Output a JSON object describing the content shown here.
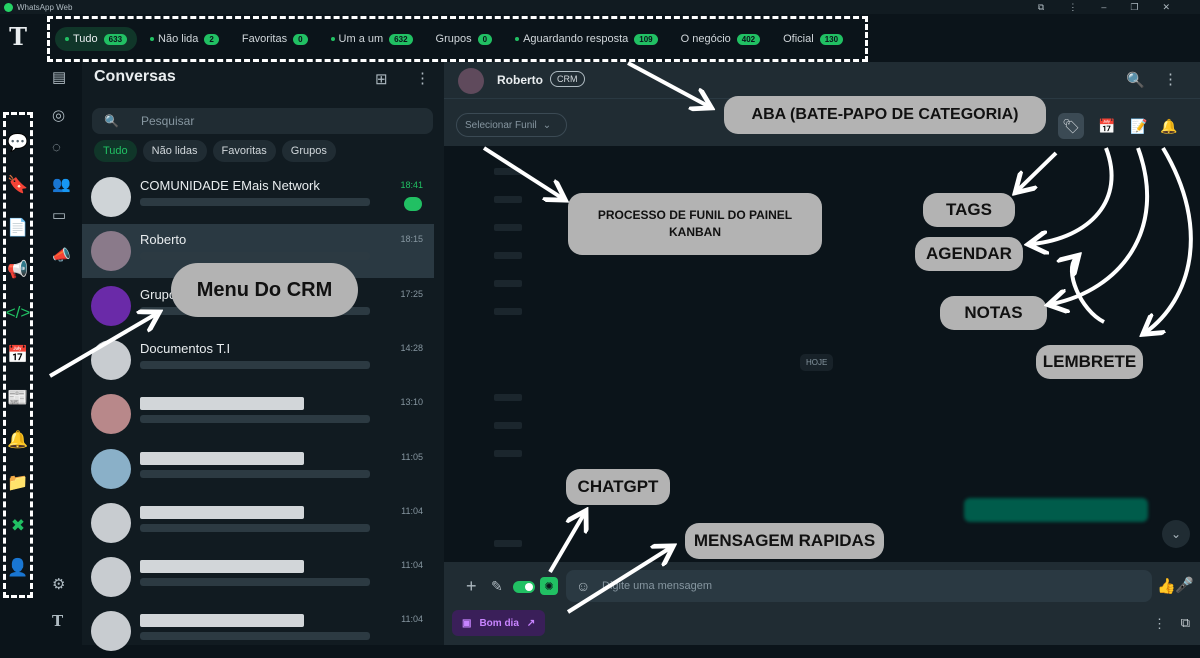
{
  "window": {
    "title": "WhatsApp Web",
    "minimize": "–",
    "restore": "❐",
    "close": "✕",
    "menu": "⋮",
    "ext": "⧉"
  },
  "brand": "T",
  "tabs": [
    {
      "label": "Tudo",
      "count": "633",
      "dot": true
    },
    {
      "label": "Não lida",
      "count": "2",
      "dot": true
    },
    {
      "label": "Favoritas",
      "count": "0",
      "dot": false
    },
    {
      "label": "Um a um",
      "count": "632",
      "dot": true
    },
    {
      "label": "Grupos",
      "count": "0",
      "dot": false
    },
    {
      "label": "Aguardando resposta",
      "count": "109",
      "dot": true
    },
    {
      "label": "O negócio",
      "count": "402",
      "dot": false
    },
    {
      "label": "Oficial",
      "count": "130",
      "dot": false
    }
  ],
  "chatlist": {
    "title": "Conversas",
    "search_placeholder": "Pesquisar",
    "filters": [
      "Tudo",
      "Não lidas",
      "Favoritas",
      "Grupos"
    ],
    "rows": [
      {
        "name": "COMUNIDADE EMais Network",
        "time": "18:41"
      },
      {
        "name": "Roberto",
        "time": "18:15"
      },
      {
        "name": "Grupo",
        "time": "17:25"
      },
      {
        "name": "Documentos T.I",
        "time": "14:28"
      },
      {
        "name": "",
        "time": "13:10"
      },
      {
        "name": "",
        "time": "11:05"
      },
      {
        "name": "",
        "time": "11:04"
      },
      {
        "name": "",
        "time": "11:04"
      },
      {
        "name": "",
        "time": "11:04"
      }
    ]
  },
  "chat": {
    "contact": "Roberto",
    "tag": "CRM",
    "funnel_placeholder": "Selecionar Funil",
    "day_label": "HOJE",
    "composer_placeholder": "Digite uma mensagem",
    "quick_reply": "Bom dia"
  },
  "callouts": {
    "aba": "ABA (BATE-PAPO DE CATEGORIA)",
    "funil": "PROCESSO DE FUNIL DO PAINEL KANBAN",
    "menu_crm": "Menu Do CRM",
    "tags": "TAGS",
    "agendar": "AGENDAR",
    "notas": "NOTAS",
    "lembrete": "LEMBRETE",
    "chatgpt": "CHATGPT",
    "mensagem": "MENSAGEM RAPIDAS"
  },
  "colors": {
    "accent": "#21c063",
    "panel": "#111b21",
    "header": "#202c33",
    "callout": "#b3b3b3"
  }
}
